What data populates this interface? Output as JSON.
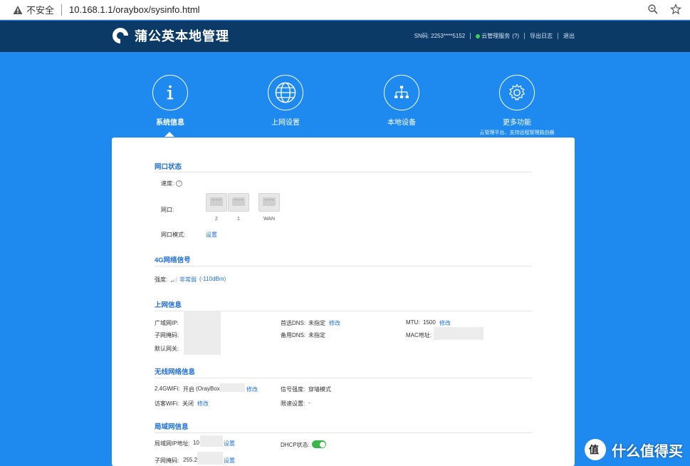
{
  "browser": {
    "insecure_label": "不安全",
    "url": "10.168.1.1/oraybox/sysinfo.html"
  },
  "header": {
    "title": "蒲公英本地管理",
    "sn": "SN码: 2253****5152",
    "cloud": "云管理服务",
    "cloud_help": "(?)",
    "export": "导出日志",
    "logout": "退出"
  },
  "nav": [
    {
      "label": "系统信息",
      "icon": "info-icon",
      "active": true
    },
    {
      "label": "上网设置",
      "icon": "globe-icon"
    },
    {
      "label": "本地设备",
      "icon": "network-tree-icon"
    },
    {
      "label": "更多功能",
      "icon": "gear-icon",
      "sub": "云管理平台、支持远程管理路由器"
    }
  ],
  "port_section": {
    "title": "网口状态",
    "speed_label": "速度:",
    "port_label": "网口:",
    "ports": [
      "2",
      "1",
      "WAN"
    ],
    "mode_label": "网口模式:",
    "mode_link": "设置"
  },
  "signal_section": {
    "title": "4G网络信号",
    "strength_label": "强度:",
    "strength_value": "非常弱",
    "dbm": "(-110dBm)"
  },
  "internet_section": {
    "title": "上网信息",
    "wan_ip_label": "广域网IP:",
    "subnet_label": "子网掩码:",
    "gateway_label": "默认网关:",
    "dns1_label": "首选DNS:",
    "dns1_value": "未指定",
    "dns1_link": "修改",
    "dns2_label": "备用DNS:",
    "dns2_value": "未指定",
    "mtu_label": "MTU:",
    "mtu_value": "1500",
    "mtu_link": "修改",
    "mac_label": "MAC地址:"
  },
  "wireless_section": {
    "title": "无线网络信息",
    "wifi24_label": "2.4GWiFi:",
    "wifi24_value": "开启",
    "wifi24_ssid": "(OrayBox",
    "wifi24_link": "修改",
    "guest_label": "访客WiFi:",
    "guest_value": "关闭",
    "guest_link": "修改",
    "signal_label": "信号强度:",
    "signal_value": "穿墙模式",
    "limit_label": "限速设置:",
    "limit_value": "-"
  },
  "lan_section": {
    "title": "局域网信息",
    "lan_ip_label": "局域网IP地址:",
    "lan_ip_value": "10",
    "lan_ip_link": "设置",
    "dhcp_label": "DHCP状态:",
    "dhcp_on": true,
    "subnet_label": "子网掩码:",
    "subnet_value": "255.2",
    "subnet_link": "设置"
  },
  "watermark": {
    "text": "什么值得买"
  }
}
